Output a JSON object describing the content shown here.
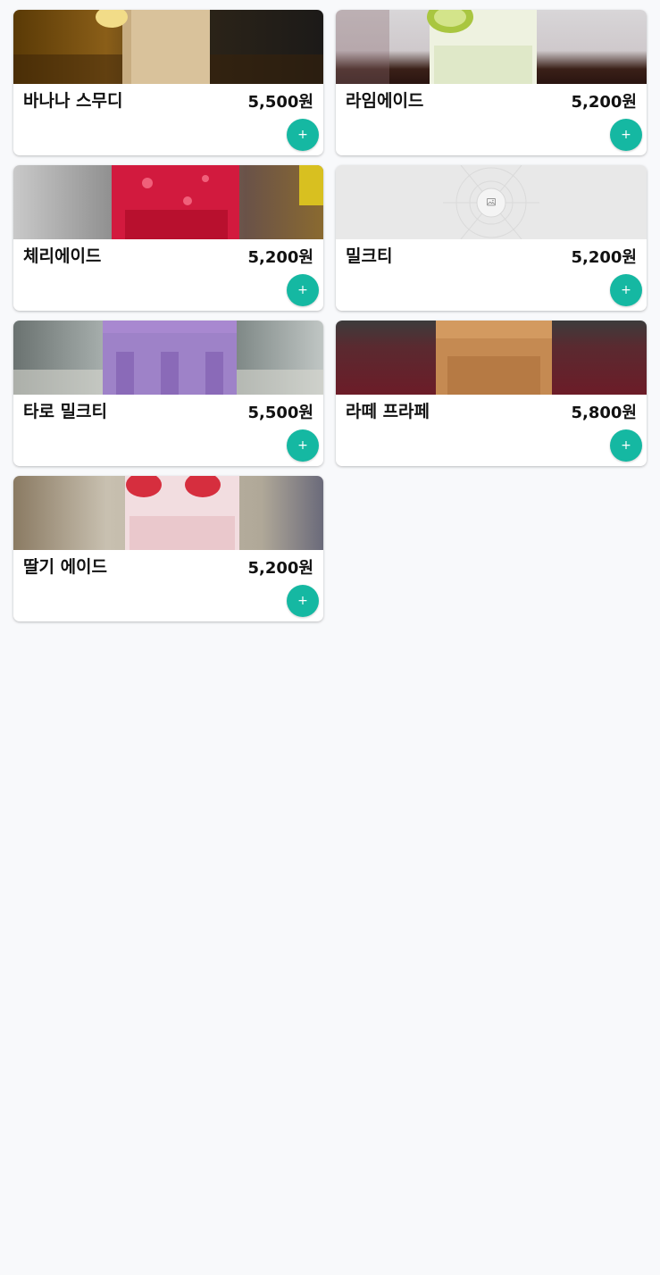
{
  "accent_color": "#15b8a2",
  "add_button_label": "+",
  "menu": {
    "items": [
      {
        "name": "바나나 스무디",
        "price": "5,500원",
        "image": "banana-smoothie-photo"
      },
      {
        "name": "라임에이드",
        "price": "5,200원",
        "image": "limeade-photo"
      },
      {
        "name": "체리에이드",
        "price": "5,200원",
        "image": "cherryade-photo"
      },
      {
        "name": "밀크티",
        "price": "5,200원",
        "image": "image-placeholder-icon"
      },
      {
        "name": "타로 밀크티",
        "price": "5,500원",
        "image": "taro-milk-tea-photo"
      },
      {
        "name": "라떼 프라페",
        "price": "5,800원",
        "image": "latte-frappe-photo"
      },
      {
        "name": "딸기 에이드",
        "price": "5,200원",
        "image": "strawberry-ade-photo"
      }
    ]
  }
}
